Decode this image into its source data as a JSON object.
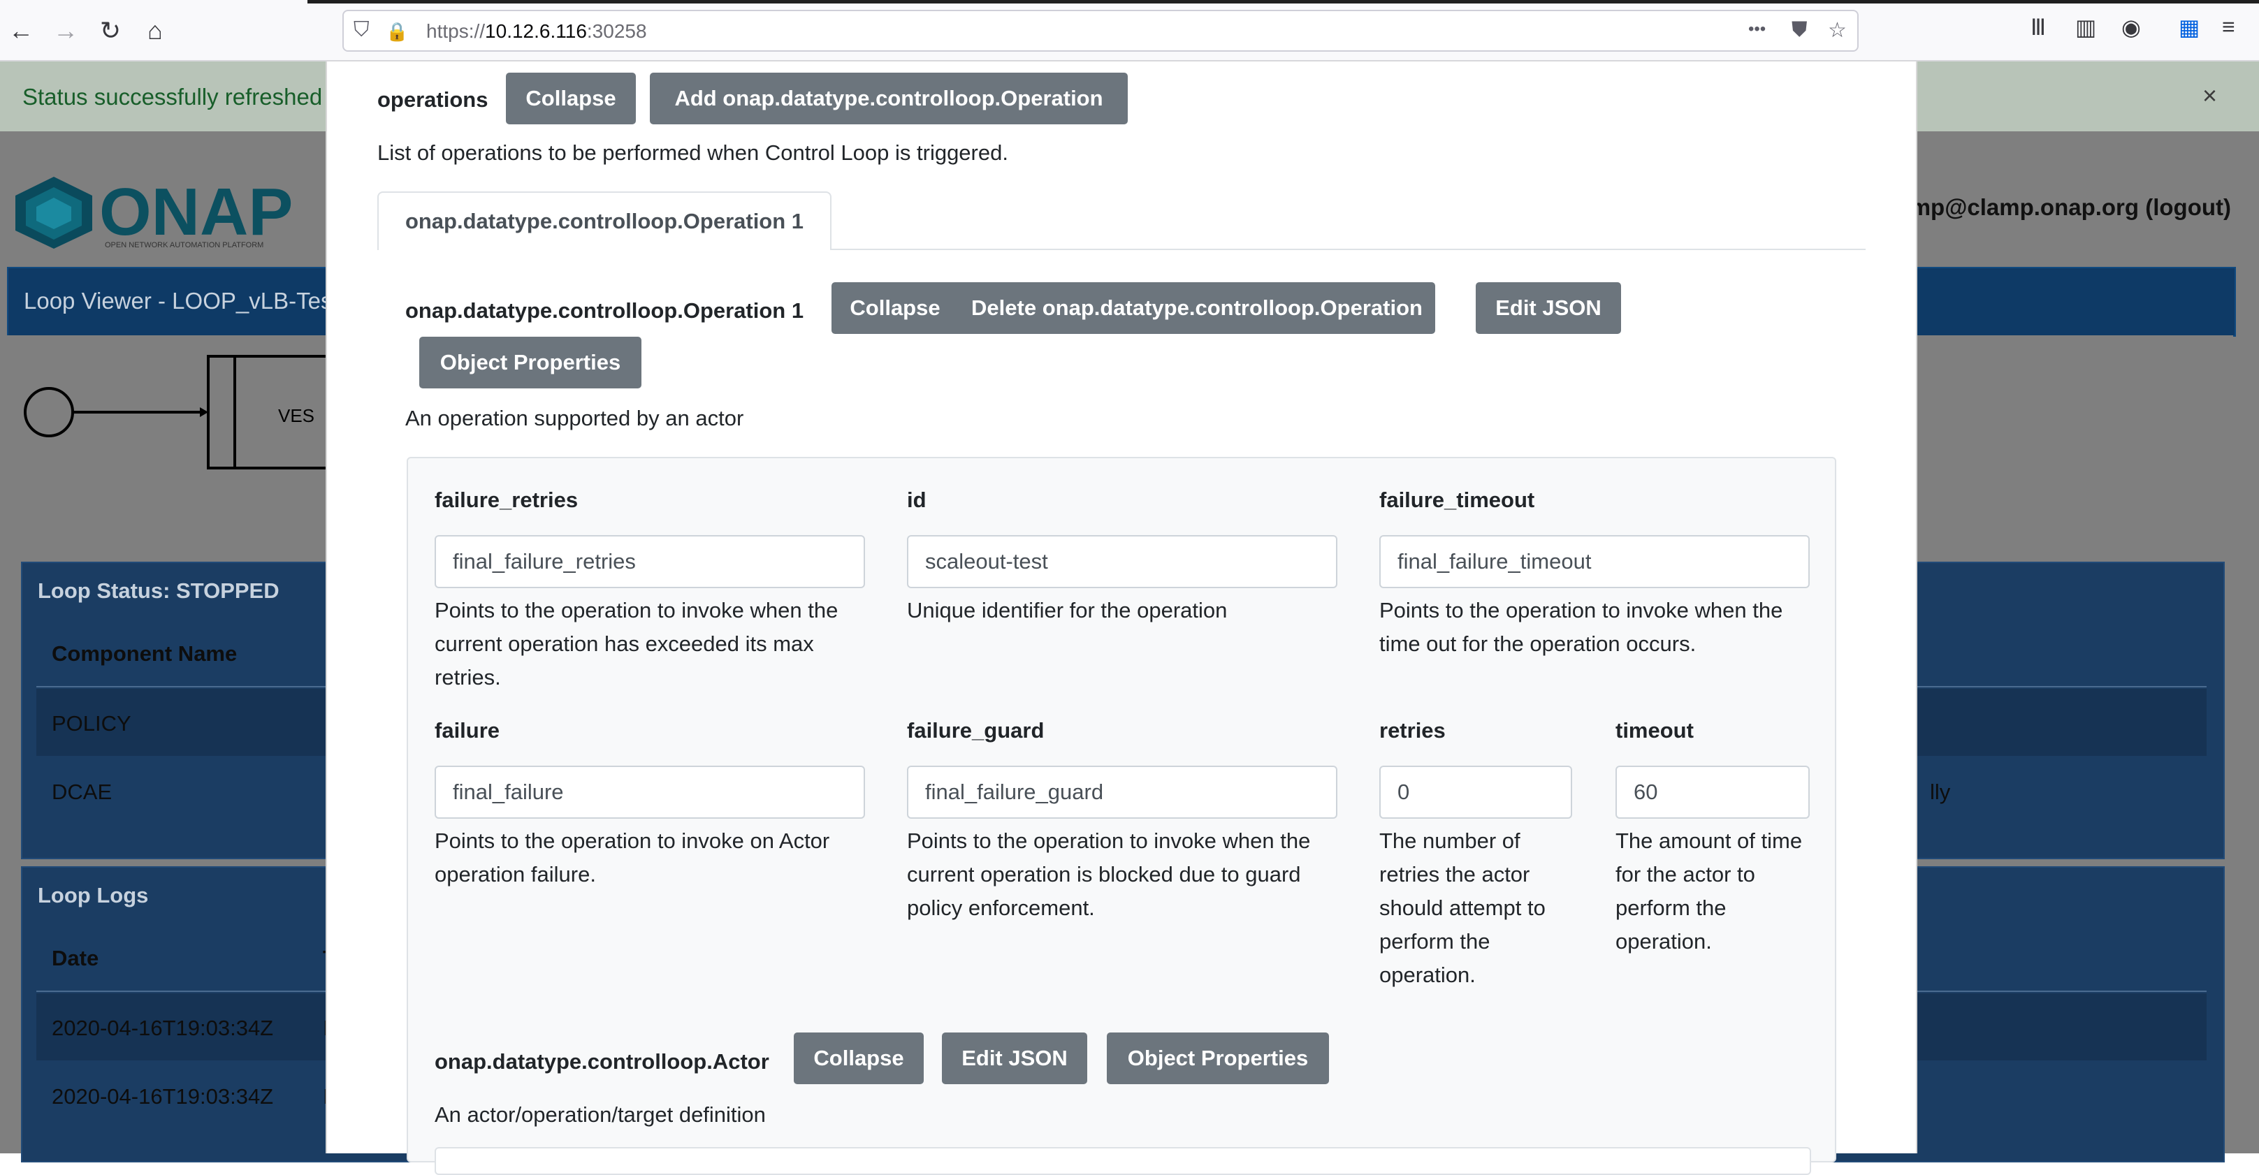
{
  "browser": {
    "url_prefix": "https://",
    "url_host": "10.12.6.116",
    "url_port": ":30258",
    "icons": {
      "back": "←",
      "forward": "→",
      "reload": "↻",
      "home": "⌂",
      "shield": "⛉",
      "lock": "🔒",
      "more": "•••",
      "pocket": "⛊",
      "star": "☆",
      "library": "Ⅲ",
      "sidebar": "▥",
      "account": "◉",
      "extensions": "▦",
      "menu": "≡"
    }
  },
  "background": {
    "alert_message": "Status successfully refreshed",
    "alert_close": "×",
    "logo_text": "ONAP",
    "logo_subtitle": "OPEN NETWORK AUTOMATION PLATFORM",
    "user_text": "mp@clamp.onap.org (logout)",
    "viewer_title": "Loop Viewer - LOOP_vLB-Test",
    "diagram_node_label": "VES",
    "loop_status_title": "Loop Status: STOPPED",
    "status_table_header": "Component Name",
    "status_rows": [
      "POLICY",
      "DCAE"
    ],
    "status_row_tail": "lly",
    "loop_logs_title": "Loop Logs",
    "logs_header_date": "Date",
    "logs_header_type": "T",
    "log_rows": [
      {
        "date": "2020-04-16T19:03:34Z",
        "type": "I"
      },
      {
        "date": "2020-04-16T19:03:34Z",
        "type": "I"
      }
    ]
  },
  "modal": {
    "operations_label": "operations",
    "collapse_label": "Collapse",
    "add_button_label": "Add onap.datatype.controlloop.Operation",
    "operations_description": "List of operations to be performed when Control Loop is triggered.",
    "tab_label": "onap.datatype.controlloop.Operation 1",
    "operation_title": "onap.datatype.controlloop.Operation 1",
    "delete_button_label": "Delete onap.datatype.controlloop.Operation",
    "edit_json_label": "Edit JSON",
    "object_properties_label": "Object Properties",
    "operation_description": "An operation supported by an actor",
    "fields": {
      "failure_retries": {
        "label": "failure_retries",
        "value": "final_failure_retries",
        "help": "Points to the operation to invoke when the current operation has exceeded its max retries."
      },
      "id": {
        "label": "id",
        "value": "scaleout-test",
        "help": "Unique identifier for the operation"
      },
      "failure_timeout": {
        "label": "failure_timeout",
        "value": "final_failure_timeout",
        "help": "Points to the operation to invoke when the time out for the operation occurs."
      },
      "failure": {
        "label": "failure",
        "value": "final_failure",
        "help": "Points to the operation to invoke on Actor operation failure."
      },
      "failure_guard": {
        "label": "failure_guard",
        "value": "final_failure_guard",
        "help": "Points to the operation to invoke when the current operation is blocked due to guard policy enforcement."
      },
      "retries": {
        "label": "retries",
        "value": "0",
        "help": "The number of retries the actor should attempt to perform the operation."
      },
      "timeout": {
        "label": "timeout",
        "value": "60",
        "help": "The amount of time for the actor to perform the operation."
      }
    },
    "actor_title": "onap.datatype.controlloop.Actor",
    "actor_description": "An actor/operation/target definition"
  }
}
